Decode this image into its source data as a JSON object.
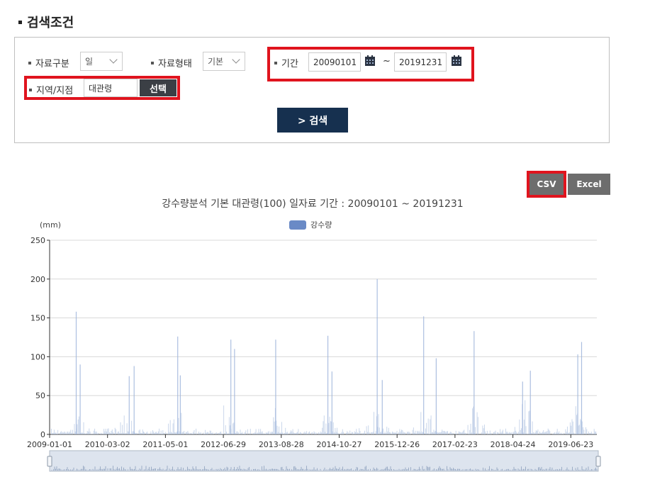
{
  "section": {
    "title": "검색조건"
  },
  "form": {
    "data_type_label": "자료구분",
    "data_type_value": "일",
    "data_form_label": "자료형태",
    "data_form_value": "기본",
    "period_label": "기간",
    "period_start": "20090101",
    "period_sep": "~",
    "period_end": "20191231",
    "region_label": "지역/지점",
    "region_value": "대관령",
    "choose_button": "선택",
    "search_button": "> 검색"
  },
  "export": {
    "csv": "CSV",
    "excel": "Excel"
  },
  "chart_data": {
    "type": "bar",
    "title": "강수량분석 기본 대관령(100) 일자료 기간 : 20090101 ~ 20191231",
    "ylabel": "(mm)",
    "xlabel": "",
    "series_name": "강수량",
    "ylim": [
      0,
      250
    ],
    "yticks": [
      "250",
      "200",
      "150",
      "100",
      "50",
      "0"
    ],
    "xticks": [
      "2009-01-01",
      "2010-03-02",
      "2011-05-01",
      "2012-06-29",
      "2013-08-28",
      "2014-10-27",
      "2015-12-26",
      "2017-02-23",
      "2018-04-24",
      "2019-06-23"
    ],
    "grid": true,
    "legend_position": "top-center",
    "color": "#6a8ac6",
    "peaks": [
      {
        "date": "2009-07-12",
        "value": 158
      },
      {
        "date": "2009-08-10",
        "value": 90
      },
      {
        "date": "2010-08-05",
        "value": 75
      },
      {
        "date": "2010-09-10",
        "value": 88
      },
      {
        "date": "2011-07-27",
        "value": 126
      },
      {
        "date": "2011-08-15",
        "value": 76
      },
      {
        "date": "2012-08-20",
        "value": 122
      },
      {
        "date": "2012-09-16",
        "value": 110
      },
      {
        "date": "2013-07-15",
        "value": 122
      },
      {
        "date": "2014-08-02",
        "value": 127
      },
      {
        "date": "2014-09-01",
        "value": 81
      },
      {
        "date": "2015-07-30",
        "value": 200
      },
      {
        "date": "2015-09-05",
        "value": 70
      },
      {
        "date": "2016-07-05",
        "value": 152
      },
      {
        "date": "2016-10-05",
        "value": 98
      },
      {
        "date": "2017-07-10",
        "value": 133
      },
      {
        "date": "2018-08-27",
        "value": 82
      },
      {
        "date": "2018-07-01",
        "value": 68
      },
      {
        "date": "2019-08-10",
        "value": 103
      },
      {
        "date": "2019-09-07",
        "value": 119
      }
    ]
  }
}
